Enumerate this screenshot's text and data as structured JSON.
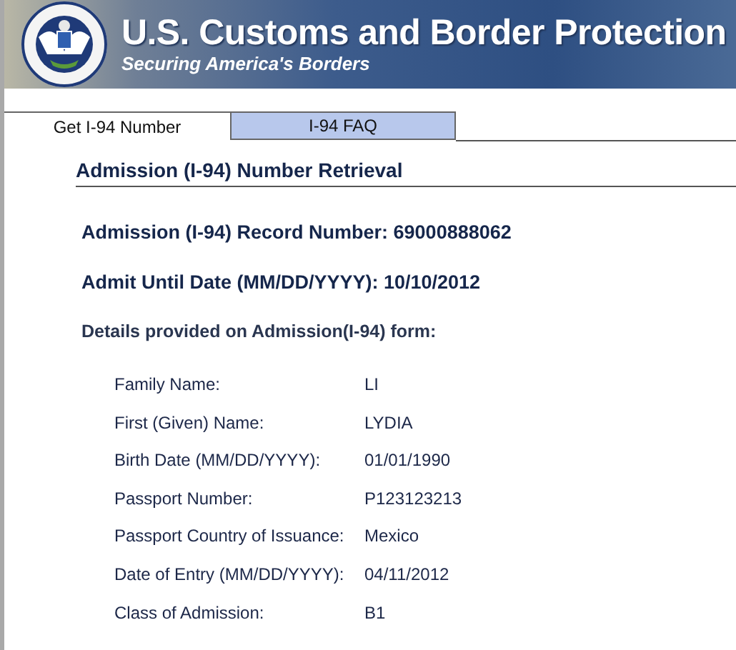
{
  "header": {
    "title": "U.S. Customs and Border Protection",
    "subtitle": "Securing America's Borders"
  },
  "tabs": [
    {
      "label": "Get I-94 Number",
      "selected": true
    },
    {
      "label": "I-94 FAQ",
      "selected": false
    }
  ],
  "section_title": "Admission (I-94) Number Retrieval",
  "record_number": "Admission (I-94) Record Number: 69000888062",
  "admit_until": "Admit Until Date (MM/DD/YYYY): 10/10/2012",
  "details_heading": "Details provided on Admission(I-94) form:",
  "details": [
    {
      "label": "Family Name:",
      "value": "LI"
    },
    {
      "label": "First (Given) Name:",
      "value": "LYDIA"
    },
    {
      "label": "Birth Date (MM/DD/YYYY):",
      "value": "01/01/1990"
    },
    {
      "label": "Passport Number:",
      "value": "P123123213"
    },
    {
      "label": "Passport Country of Issuance:",
      "value": "Mexico"
    },
    {
      "label": "Date of Entry (MM/DD/YYYY):",
      "value": "04/11/2012"
    },
    {
      "label": "Class of Admission:",
      "value": "B1"
    }
  ]
}
